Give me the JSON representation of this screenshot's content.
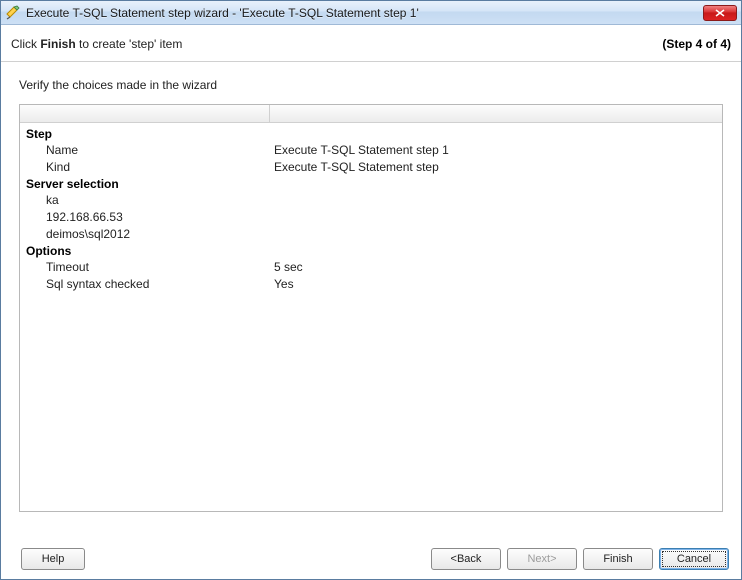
{
  "window": {
    "title": "Execute T-SQL Statement step wizard - 'Execute T-SQL Statement step 1'"
  },
  "header": {
    "prefix": "Click ",
    "bold": "Finish",
    "suffix": " to create 'step' item",
    "progress": "(Step 4 of 4)"
  },
  "subhead": "Verify the choices made in the wizard",
  "summary": {
    "section_step": "Step",
    "name_label": "Name",
    "name_value": "Execute T-SQL Statement step 1",
    "kind_label": "Kind",
    "kind_value": "Execute T-SQL Statement step",
    "section_server": "Server selection",
    "server1": "ka",
    "server2": "192.168.66.53",
    "server3": "deimos\\sql2012",
    "section_options": "Options",
    "timeout_label": "Timeout",
    "timeout_value": "5 sec",
    "syntax_label": "Sql syntax checked",
    "syntax_value": "Yes"
  },
  "buttons": {
    "help": "Help",
    "back": "<Back",
    "next": "Next>",
    "finish": "Finish",
    "cancel": "Cancel"
  }
}
